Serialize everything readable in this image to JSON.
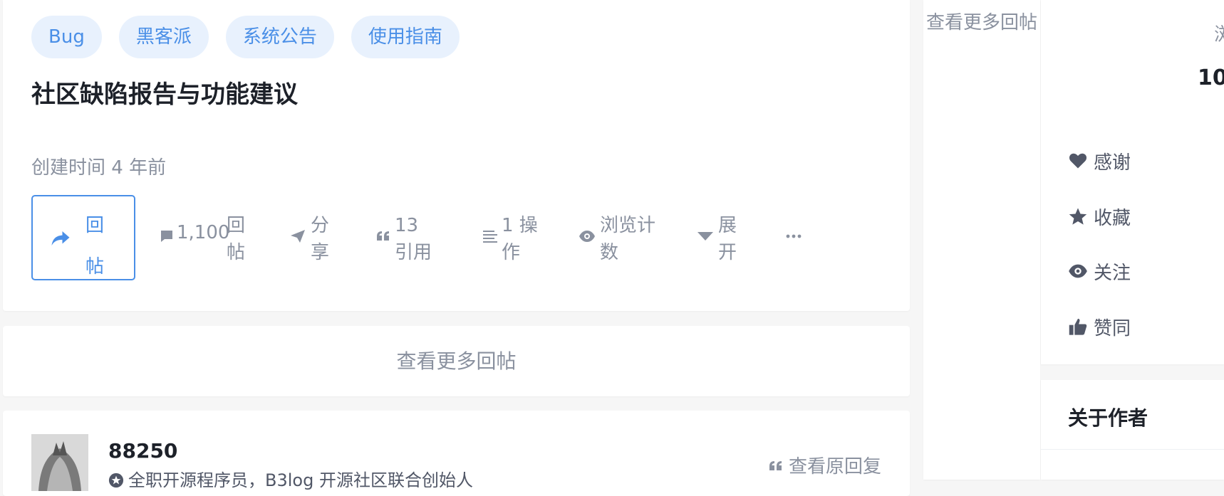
{
  "post": {
    "tags": [
      "Bug",
      "黑客派",
      "系统公告",
      "使用指南"
    ],
    "title": "社区缺陷报告与功能建议",
    "created": "创建时间 4 年前",
    "actions": {
      "reply": "回帖",
      "reply_count": "1,100",
      "reply_count_label": "回帖",
      "share": "分享",
      "quote": "13 引用",
      "ops": "1 操作",
      "views": "浏览计数",
      "expand": "展开"
    }
  },
  "more_replies": "查看更多回帖",
  "mid_column": {
    "more_replies": "查看更多回帖"
  },
  "reply": {
    "username": "88250",
    "bio": "全职开源程序员，B3log 开源社区联合创始人",
    "quote_link": "查看原回复"
  },
  "sidebar": {
    "peek_top": "浏",
    "peek_num": "10",
    "items": [
      {
        "label": "感谢",
        "icon": "heart-icon"
      },
      {
        "label": "收藏",
        "icon": "star-icon"
      },
      {
        "label": "关注",
        "icon": "eye-icon"
      },
      {
        "label": "赞同",
        "icon": "thumbs-up-icon"
      }
    ],
    "about_title": "关于作者"
  },
  "colors": {
    "accent": "#4a8fe7",
    "tag_bg": "#e8f1fd",
    "muted": "#8a919f",
    "page_bg": "#f6f6f6"
  }
}
